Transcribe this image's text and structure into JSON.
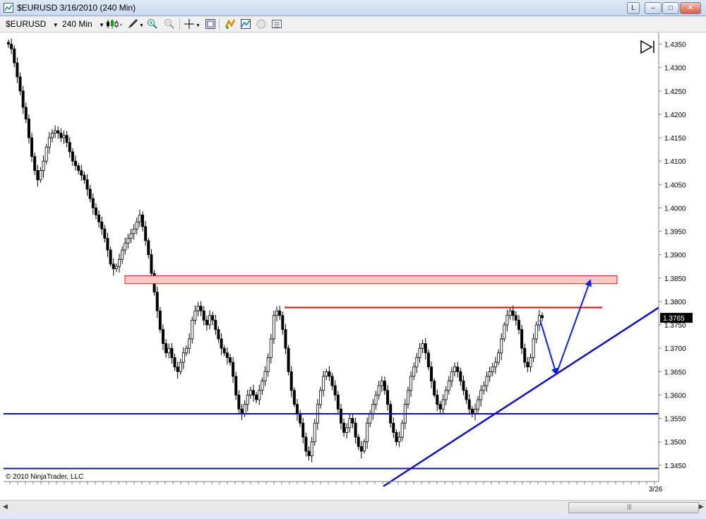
{
  "window": {
    "title": "$EURUSD  3/16/2010 (240 Min)",
    "buttons": [
      "L",
      "–",
      "□",
      "✕"
    ]
  },
  "toolbar": {
    "instrument": "$EURUSD",
    "interval": "240 Min"
  },
  "chart": {
    "copyright": "© 2010 NinjaTrader, LLC",
    "x_tick_label": "3/26",
    "current_price_label": "1.3765"
  },
  "chart_data": {
    "type": "candlestick",
    "symbol": "$EURUSD",
    "interval": "240 Min",
    "y_ticks": [
      "1.4350",
      "1.4300",
      "1.4250",
      "1.4200",
      "1.4150",
      "1.4100",
      "1.4050",
      "1.4000",
      "1.3950",
      "1.3900",
      "1.3850",
      "1.3800",
      "1.3750",
      "1.3700",
      "1.3650",
      "1.3600",
      "1.3550",
      "1.3500",
      "1.3450"
    ],
    "ylim": [
      1.3415,
      1.4375
    ],
    "last_price": 1.3765,
    "close_path": [
      1.435,
      1.434,
      1.431,
      1.428,
      1.425,
      1.4215,
      1.419,
      1.415,
      1.411,
      1.408,
      1.406,
      1.408,
      1.41,
      1.413,
      1.415,
      1.416,
      1.4165,
      1.416,
      1.415,
      1.4155,
      1.414,
      1.412,
      1.41,
      1.409,
      1.408,
      1.407,
      1.406,
      1.404,
      1.402,
      1.4,
      1.3985,
      1.397,
      1.3955,
      1.3935,
      1.391,
      1.388,
      1.387,
      1.3875,
      1.389,
      1.391,
      1.3925,
      1.3935,
      1.3945,
      1.3955,
      1.397,
      1.3985,
      1.396,
      1.393,
      1.39,
      1.386,
      1.382,
      1.378,
      1.374,
      1.371,
      1.369,
      1.37,
      1.368,
      1.366,
      1.365,
      1.367,
      1.369,
      1.37,
      1.372,
      1.376,
      1.378,
      1.379,
      1.378,
      1.376,
      1.375,
      1.377,
      1.376,
      1.374,
      1.372,
      1.37,
      1.369,
      1.368,
      1.367,
      1.364,
      1.36,
      1.357,
      1.356,
      1.358,
      1.36,
      1.361,
      1.36,
      1.359,
      1.361,
      1.363,
      1.365,
      1.368,
      1.372,
      1.377,
      1.378,
      1.377,
      1.374,
      1.37,
      1.365,
      1.361,
      1.358,
      1.356,
      1.354,
      1.351,
      1.348,
      1.347,
      1.35,
      1.354,
      1.358,
      1.361,
      1.364,
      1.365,
      1.364,
      1.362,
      1.36,
      1.357,
      1.354,
      1.352,
      1.353,
      1.355,
      1.354,
      1.351,
      1.349,
      1.348,
      1.35,
      1.354,
      1.356,
      1.358,
      1.36,
      1.362,
      1.363,
      1.361,
      1.358,
      1.354,
      1.352,
      1.35,
      1.351,
      1.354,
      1.358,
      1.361,
      1.364,
      1.366,
      1.368,
      1.37,
      1.371,
      1.369,
      1.366,
      1.363,
      1.36,
      1.358,
      1.357,
      1.359,
      1.361,
      1.363,
      1.365,
      1.366,
      1.365,
      1.363,
      1.361,
      1.359,
      1.357,
      1.356,
      1.357,
      1.359,
      1.361,
      1.362,
      1.364,
      1.365,
      1.366,
      1.367,
      1.369,
      1.372,
      1.375,
      1.377,
      1.378,
      1.377,
      1.376,
      1.374,
      1.37,
      1.367,
      1.366,
      1.368,
      1.372,
      1.375,
      1.377,
      1.3765
    ],
    "annotations": [
      {
        "type": "resistance-zone",
        "from": 1.3838,
        "to": 1.3855,
        "fill": "#f8c8c8",
        "stroke": "#cc2020"
      },
      {
        "type": "horizontal-line",
        "value": 1.3787,
        "color": "#cc1010"
      },
      {
        "type": "horizontal-line",
        "value": 1.356,
        "color": "#1010c0"
      },
      {
        "type": "horizontal-line",
        "value": 1.3443,
        "color": "#1010c0"
      },
      {
        "type": "trendline",
        "from": 1.3405,
        "to": 1.3787,
        "color": "#1010c0"
      },
      {
        "type": "arrow-path",
        "points": [
          1.376,
          1.3645,
          1.3845
        ],
        "color": "#1020e0"
      }
    ]
  }
}
